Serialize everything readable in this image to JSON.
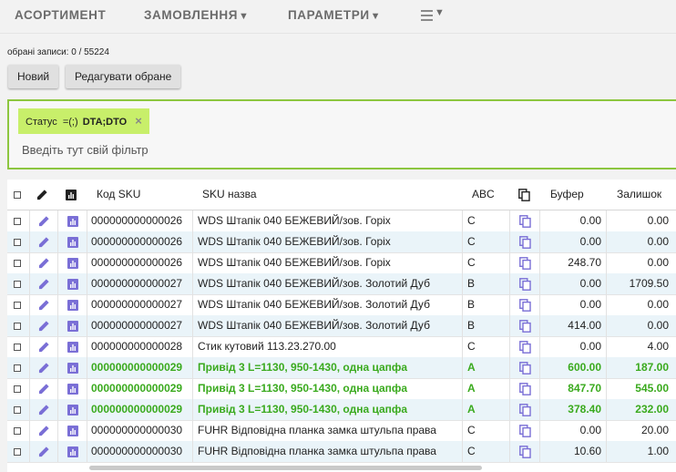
{
  "nav": {
    "items": [
      {
        "label": "АСОРТИМЕНТ",
        "caret": ""
      },
      {
        "label": "ЗАМОВЛЕННЯ",
        "caret": "▼"
      },
      {
        "label": "ПАРАМЕТРИ",
        "caret": "▼"
      }
    ],
    "menu_caret": "▼"
  },
  "toolbar": {
    "selection": "обрані записи: 0 / 55224",
    "new_label": "Новий",
    "edit_label": "Редагувати обране"
  },
  "filter": {
    "chip": {
      "field": "Статус",
      "op": "=(;)",
      "value": "DTA;DTO",
      "close": "×"
    },
    "placeholder": "Введіть тут свій фільтр"
  },
  "table": {
    "headers": {
      "sku_code": "Код SKU",
      "sku_name": "SKU назва",
      "abc": "ABC",
      "buffer": "Буфер",
      "stock": "Залишок"
    },
    "rows": [
      {
        "code": "000000000000026",
        "name": "WDS Штапік 040 БЕЖЕВИЙ/зов. Горіх",
        "abc": "C",
        "buffer": "0.00",
        "stock": "0.00",
        "highlight": false
      },
      {
        "code": "000000000000026",
        "name": "WDS Штапік 040 БЕЖЕВИЙ/зов. Горіх",
        "abc": "C",
        "buffer": "0.00",
        "stock": "0.00",
        "highlight": false
      },
      {
        "code": "000000000000026",
        "name": "WDS Штапік 040 БЕЖЕВИЙ/зов. Горіх",
        "abc": "C",
        "buffer": "248.70",
        "stock": "0.00",
        "highlight": false
      },
      {
        "code": "000000000000027",
        "name": "WDS Штапік 040 БЕЖЕВИЙ/зов. Золотий Дуб",
        "abc": "B",
        "buffer": "0.00",
        "stock": "1709.50",
        "highlight": false
      },
      {
        "code": "000000000000027",
        "name": "WDS Штапік 040 БЕЖЕВИЙ/зов. Золотий Дуб",
        "abc": "B",
        "buffer": "0.00",
        "stock": "0.00",
        "highlight": false
      },
      {
        "code": "000000000000027",
        "name": "WDS Штапік 040 БЕЖЕВИЙ/зов. Золотий Дуб",
        "abc": "B",
        "buffer": "414.00",
        "stock": "0.00",
        "highlight": false
      },
      {
        "code": "000000000000028",
        "name": "Стик кутовий 113.23.270.00",
        "abc": "C",
        "buffer": "0.00",
        "stock": "4.00",
        "highlight": false
      },
      {
        "code": "000000000000029",
        "name": "Привід 3 L=1130, 950-1430, одна цапфа",
        "abc": "A",
        "buffer": "600.00",
        "stock": "187.00",
        "highlight": true
      },
      {
        "code": "000000000000029",
        "name": "Привід 3 L=1130, 950-1430, одна цапфа",
        "abc": "A",
        "buffer": "847.70",
        "stock": "545.00",
        "highlight": true
      },
      {
        "code": "000000000000029",
        "name": "Привід 3 L=1130, 950-1430, одна цапфа",
        "abc": "A",
        "buffer": "378.40",
        "stock": "232.00",
        "highlight": true
      },
      {
        "code": "000000000000030",
        "name": "FUHR Відповідна планка замка штульпа права",
        "abc": "C",
        "buffer": "0.00",
        "stock": "20.00",
        "highlight": false
      },
      {
        "code": "000000000000030",
        "name": "FUHR Відповідна планка замка штульпа права",
        "abc": "C",
        "buffer": "10.60",
        "stock": "1.00",
        "highlight": false
      }
    ]
  },
  "colors": {
    "accent": "#8cc63f",
    "chip": "#c8ef6a",
    "highlight_text": "#3aaa1e",
    "icon": "#7a6fd6",
    "row_alt": "#eaf4f9"
  }
}
